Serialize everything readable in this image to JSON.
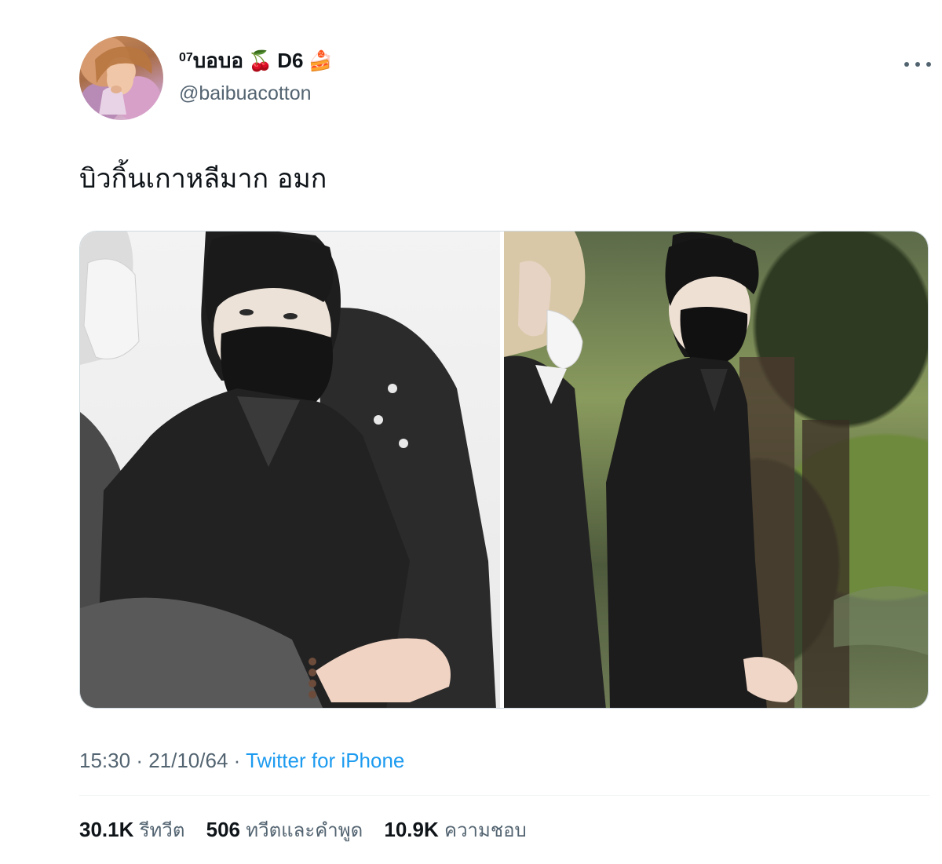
{
  "author": {
    "name_prefix": "07",
    "name_main": "บอบอ",
    "name_emoji_1": "🍒",
    "name_suffix": "D6",
    "name_emoji_2": "🍰",
    "handle": "@baibuacotton"
  },
  "tweet": {
    "text": "บิวกิ้นเกาหลีมาก อมก"
  },
  "meta": {
    "time": "15:30",
    "date": "21/10/64",
    "source": "Twitter for iPhone"
  },
  "stats": {
    "retweets": "30.1K",
    "retweets_label": "รีทวีต",
    "quotes": "506",
    "quotes_label": "ทวีตและคำพูด",
    "likes": "10.9K",
    "likes_label": "ความชอบ"
  },
  "icons": {
    "more": "more-horizontal-icon"
  }
}
